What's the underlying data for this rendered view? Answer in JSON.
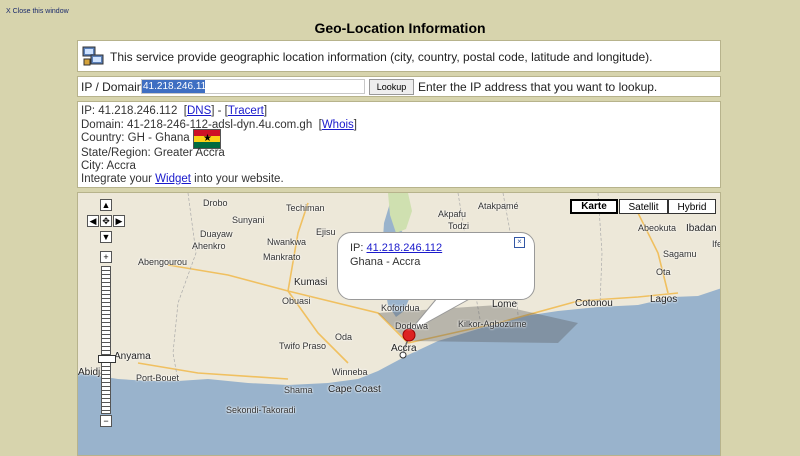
{
  "close_link": "X Close this window",
  "title": "Geo-Location Information",
  "description": "This service provide geographic location information (city, country, postal code, latitude and longitude).",
  "lookup": {
    "label": "IP / Domain",
    "value": "41.218.246.112",
    "button": "Lookup",
    "hint": "Enter the IP address that you want to lookup."
  },
  "info": {
    "ip_prefix": "IP: ",
    "ip": "41.218.246.112",
    "dns_link": "DNS",
    "sep": "-",
    "tracert_link": "Tracert",
    "domain_prefix": "Domain: ",
    "domain": "41-218-246-112-adsl-dyn.4u.com.gh",
    "whois_link": "Whois",
    "country": "Country: GH - Ghana",
    "region": "State/Region: Greater Accra",
    "city": "City: Accra",
    "integrate_pre": "Integrate your ",
    "widget_link": "Widget",
    "integrate_post": " into your website."
  },
  "map": {
    "types": [
      "Karte",
      "Satellit",
      "Hybrid"
    ],
    "active_type": "Karte",
    "bubble_ip_label": "IP: ",
    "bubble_ip": "41.218.246.112",
    "bubble_place": "Ghana - Accra",
    "labels": {
      "drobo": "Drobo",
      "techiman": "Techiman",
      "atakpame": "Atakpamé",
      "sunyani": "Sunyani",
      "akpafu": "Akpafu",
      "todzi": "Todzi",
      "abeokuta": "Abeokuta",
      "ibadan": "Ibadan",
      "ejisu": "Ejisu",
      "duayaw": "Duayaw",
      "nwankwa": "Nwankwa",
      "ife": "Ife",
      "abengourou": "Abengourou",
      "ahenkro": "Ahenkro",
      "mankrato": "Mankrato",
      "sagamu": "Sagamu",
      "kumasi": "Kumasi",
      "ota": "Ota",
      "lagos": "Lagos",
      "obuasi": "Obuasi",
      "koforidua": "Koforidua",
      "lome": "Lome",
      "cotonou": "Cotonou",
      "kilkor": "Kilkor-Agbozume",
      "dodowa": "Dodowa",
      "twifo": "Twifo Praso",
      "oda": "Oda",
      "anyama": "Anyama",
      "accra": "Accra",
      "abidjan": "Abidjan",
      "portbouet": "Port-Bouet",
      "winneba": "Winneba",
      "shama": "Shama",
      "capecoast": "Cape Coast",
      "sekondi": "Sekondi-Takoradi"
    }
  }
}
